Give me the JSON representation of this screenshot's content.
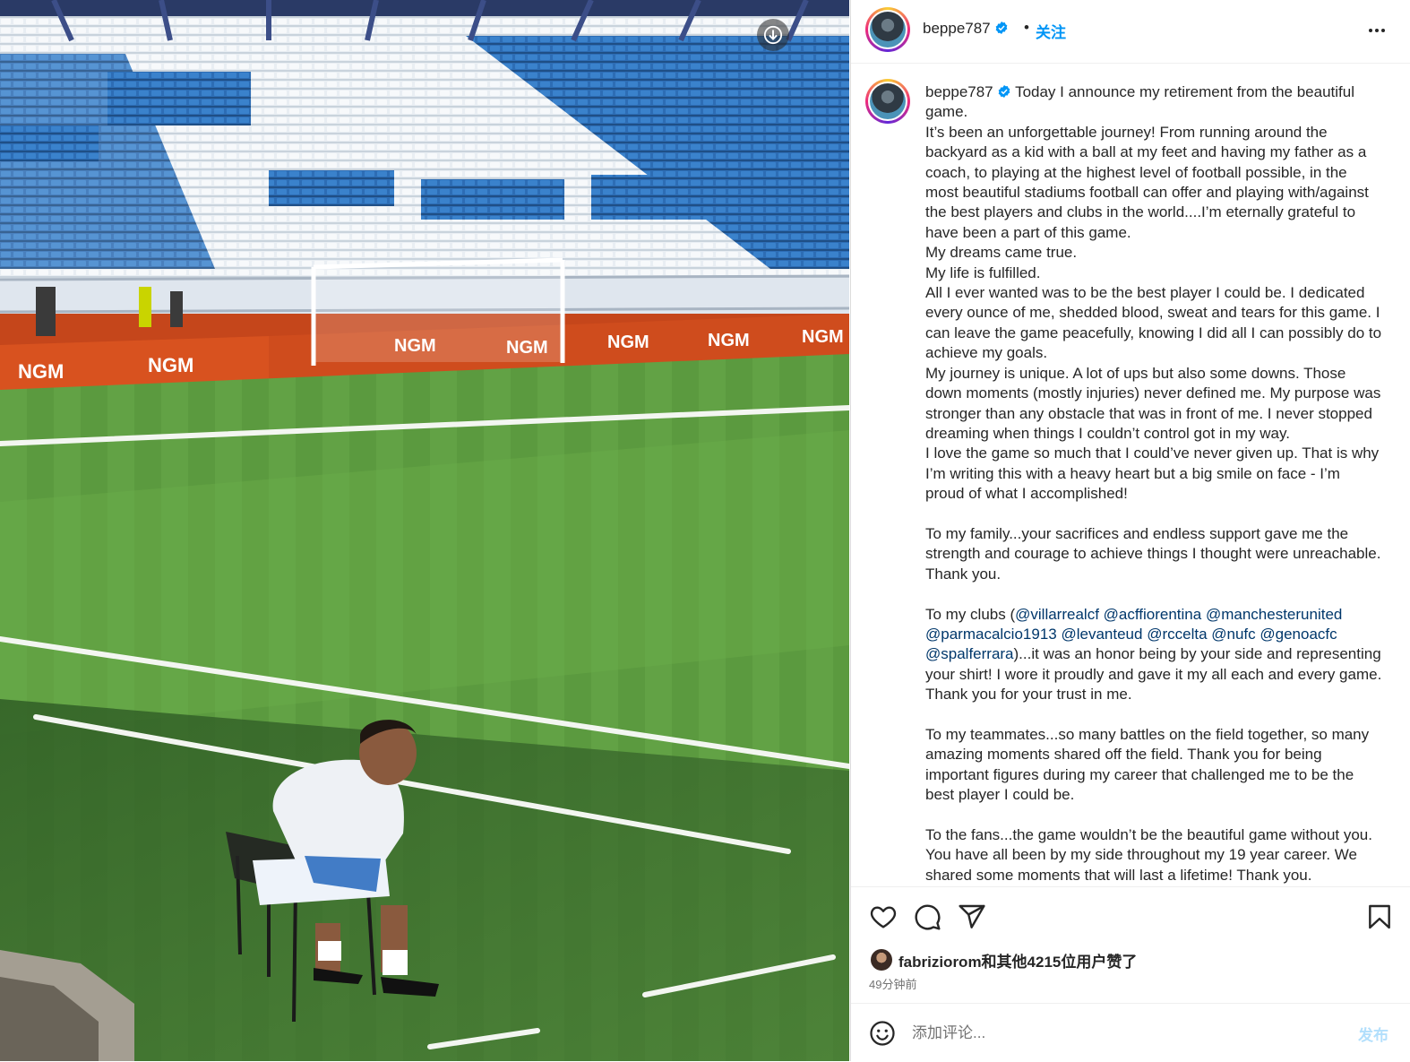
{
  "header": {
    "username": "beppe787",
    "separator": "•",
    "follow_label": "关注"
  },
  "caption": {
    "username": "beppe787",
    "paragraphs": [
      "Today I announce my retirement from the beautiful game.\nIt’s been an unforgettable journey! From running around the backyard as a kid with a ball at my feet and having my father as a coach, to playing at the highest level of football possible, in the most beautiful stadiums football can offer and playing with/against the best players and clubs in the world....I’m eternally grateful to have been a part of this game.\nMy dreams came true.\nMy life is fulfilled.\nAll I ever wanted was to be the best player I could be. I dedicated every ounce of me, shedded blood, sweat and tears for this game. I can leave the game peacefully, knowing I did all I can possibly do to achieve my goals.\nMy journey is unique. A lot of ups but also some downs. Those down moments (mostly injuries) never defined me. My purpose was stronger than any obstacle that was in front of me. I never stopped dreaming when things I couldn’t control got in my way.\nI love the game so much that I could’ve never given up. That is why I’m writing this with a heavy heart but a big smile on face - I’m proud of what I accomplished!",
      "To my family...your sacrifices and endless support gave me the strength and courage to achieve things I thought were unreachable. Thank you."
    ],
    "clubs_prefix": "To my clubs (",
    "mentions": [
      "@villarrealcf",
      "@acffiorentina",
      "@manchesterunited",
      "@parmacalcio1913",
      "@levanteud",
      "@rccelta",
      "@nufc",
      "@genoacfc",
      "@spalferrara"
    ],
    "clubs_suffix": ")...it was an honor being by your side and representing your shirt! I wore it proudly and gave it my all each and every game. Thank you for your trust in me.",
    "paragraphs_after": [
      "To my teammates...so many battles on the field together, so many amazing moments shared off the field. Thank you for being important figures during my career that challenged me to be the best player I could be.",
      "To the fans...the game wouldn’t be the beautiful game without you. You have all been by my side throughout my 19 year career. We shared some moments that will last a lifetime! Thank you."
    ]
  },
  "likes": {
    "text": "fabriziorom和其他4215位用户赞了",
    "time_ago": "49分钟前"
  },
  "comment": {
    "placeholder": "添加评论...",
    "post_label": "发布"
  },
  "media": {
    "banner_text": "NGM",
    "icon": "arrow-down-circle-icon"
  },
  "colors": {
    "follow_blue": "#0095f6",
    "mention_navy": "#00376b",
    "verified_blue": "#0095f6",
    "post_disabled": "#b2dffc"
  }
}
